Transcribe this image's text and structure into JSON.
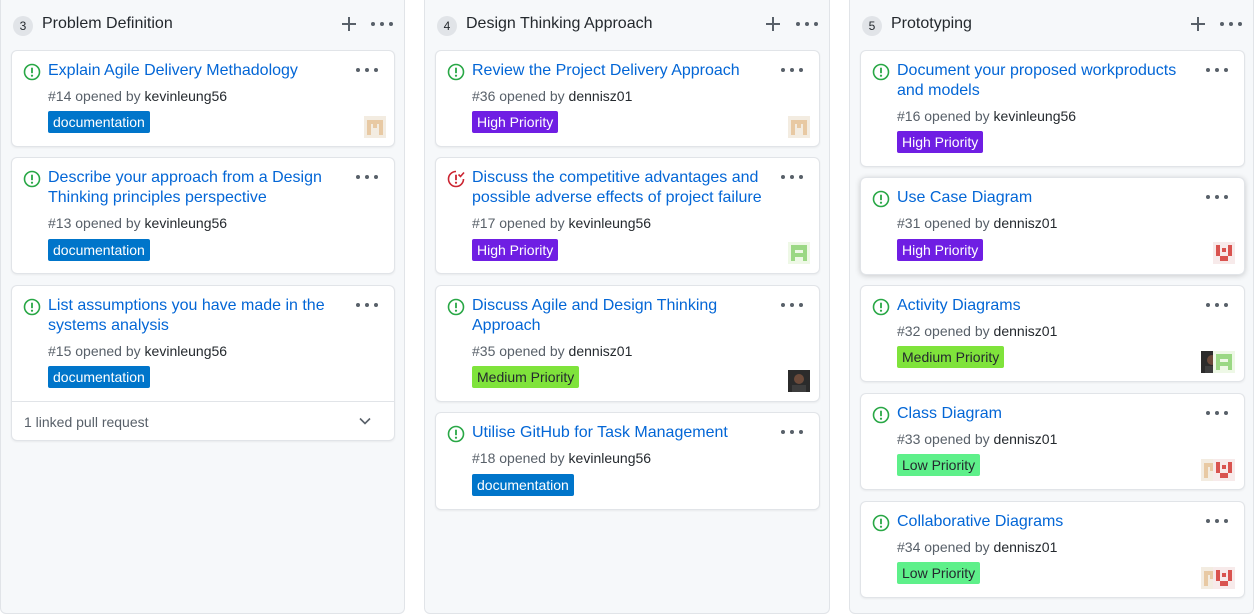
{
  "columns": [
    {
      "count": "3",
      "title": "Problem Definition",
      "cards": [
        {
          "title": "Explain Agile Delivery Methadology",
          "number": "#14",
          "opened": "opened by",
          "author": "kevinleung56",
          "label": "documentation",
          "label_color": "#0075ca",
          "label_text_color": "#ffffff",
          "status": "open"
        },
        {
          "title": "Describe your approach from a Design Thinking principles perspective",
          "number": "#13",
          "opened": "opened by",
          "author": "kevinleung56",
          "label": "documentation",
          "label_color": "#0075ca",
          "label_text_color": "#ffffff",
          "status": "open"
        },
        {
          "title": "List assumptions you have made in the systems analysis",
          "number": "#15",
          "opened": "opened by",
          "author": "kevinleung56",
          "label": "documentation",
          "label_color": "#0075ca",
          "label_text_color": "#ffffff",
          "status": "open",
          "footer": "1 linked pull request"
        }
      ]
    },
    {
      "count": "4",
      "title": "Design Thinking Approach",
      "cards": [
        {
          "title": "Review the Project Delivery Approach",
          "number": "#36",
          "opened": "opened by",
          "author": "dennisz01",
          "label": "High Priority",
          "label_color": "#6f1ee3",
          "label_text_color": "#ffffff",
          "status": "open"
        },
        {
          "title": "Discuss the competitive advantages and possible adverse effects of project failure",
          "number": "#17",
          "opened": "opened by",
          "author": "kevinleung56",
          "label": "High Priority",
          "label_color": "#6f1ee3",
          "label_text_color": "#ffffff",
          "status": "in-progress"
        },
        {
          "title": "Discuss Agile and Design Thinking Approach",
          "number": "#35",
          "opened": "opened by",
          "author": "dennisz01",
          "label": "Medium Priority",
          "label_color": "#7fe33b",
          "label_text_color": "#24292e",
          "status": "open"
        },
        {
          "title": "Utilise GitHub for Task Management",
          "number": "#18",
          "opened": "opened by",
          "author": "kevinleung56",
          "label": "documentation",
          "label_color": "#0075ca",
          "label_text_color": "#ffffff",
          "status": "open"
        }
      ]
    },
    {
      "count": "5",
      "title": "Prototyping",
      "cards": [
        {
          "title": "Document your proposed workproducts and models",
          "number": "#16",
          "opened": "opened by",
          "author": "kevinleung56",
          "label": "High Priority",
          "label_color": "#6f1ee3",
          "label_text_color": "#ffffff",
          "status": "open"
        },
        {
          "title": "Use Case Diagram",
          "number": "#31",
          "opened": "opened by",
          "author": "dennisz01",
          "label": "High Priority",
          "label_color": "#6f1ee3",
          "label_text_color": "#ffffff",
          "status": "open"
        },
        {
          "title": "Activity Diagrams",
          "number": "#32",
          "opened": "opened by",
          "author": "dennisz01",
          "label": "Medium Priority",
          "label_color": "#7fe33b",
          "label_text_color": "#24292e",
          "status": "open"
        },
        {
          "title": "Class Diagram",
          "number": "#33",
          "opened": "opened by",
          "author": "dennisz01",
          "label": "Low Priority",
          "label_color": "#5ef08a",
          "label_text_color": "#24292e",
          "status": "open"
        },
        {
          "title": "Collaborative Diagrams",
          "number": "#34",
          "opened": "opened by",
          "author": "dennisz01",
          "label": "Low Priority",
          "label_color": "#5ef08a",
          "label_text_color": "#24292e",
          "status": "open"
        }
      ]
    }
  ],
  "colors": {
    "open_icon": "#28a745",
    "in_progress_icon": "#cb2431",
    "link": "#0366d6"
  }
}
